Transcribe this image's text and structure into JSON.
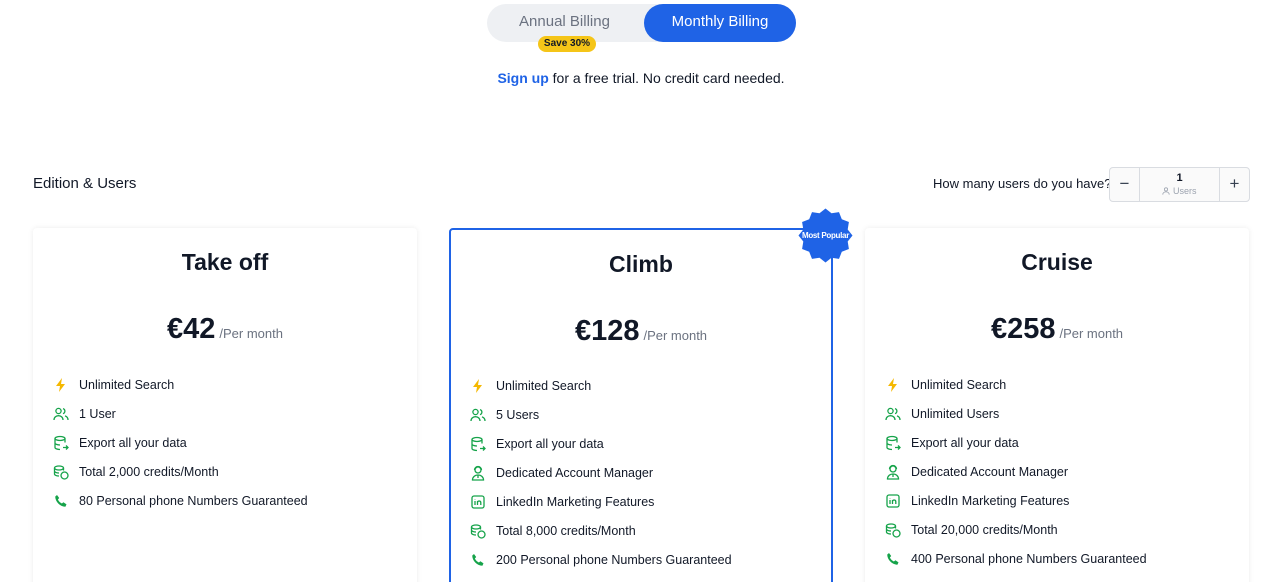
{
  "billing": {
    "annual_label": "Annual Billing",
    "monthly_label": "Monthly Billing",
    "save_badge": "Save 30%",
    "active": "monthly"
  },
  "signup": {
    "link_text": "Sign up",
    "rest_text": " for a free trial. No credit card needed."
  },
  "section_title": "Edition & Users",
  "users": {
    "question": "How many users do you have?",
    "value": "1",
    "unit": "Users",
    "minus": "−",
    "plus": "+"
  },
  "popular_badge": "Most Popular",
  "plans": [
    {
      "name": "Take off",
      "price": "€42",
      "period": "/Per month",
      "features": [
        {
          "icon": "lightning-icon",
          "text": "Unlimited Search"
        },
        {
          "icon": "users-icon",
          "text": "1 User"
        },
        {
          "icon": "export-database-icon",
          "text": "Export all your data"
        },
        {
          "icon": "coins-icon",
          "text": "Total 2,000 credits/Month"
        },
        {
          "icon": "phone-icon",
          "text": "80 Personal phone Numbers Guaranteed"
        }
      ]
    },
    {
      "name": "Climb",
      "price": "€128",
      "period": "/Per month",
      "features": [
        {
          "icon": "lightning-icon",
          "text": "Unlimited Search"
        },
        {
          "icon": "users-icon",
          "text": "5 Users"
        },
        {
          "icon": "export-database-icon",
          "text": "Export all your data"
        },
        {
          "icon": "account-manager-icon",
          "text": "Dedicated Account Manager"
        },
        {
          "icon": "linkedin-icon",
          "text": "LinkedIn Marketing Features"
        },
        {
          "icon": "coins-icon",
          "text": "Total 8,000 credits/Month"
        },
        {
          "icon": "phone-icon",
          "text": "200 Personal phone Numbers Guaranteed"
        }
      ]
    },
    {
      "name": "Cruise",
      "price": "€258",
      "period": "/Per month",
      "features": [
        {
          "icon": "lightning-icon",
          "text": "Unlimited Search"
        },
        {
          "icon": "users-icon",
          "text": "Unlimited Users"
        },
        {
          "icon": "export-database-icon",
          "text": "Export all your data"
        },
        {
          "icon": "account-manager-icon",
          "text": "Dedicated Account Manager"
        },
        {
          "icon": "linkedin-icon",
          "text": "LinkedIn Marketing Features"
        },
        {
          "icon": "coins-icon",
          "text": "Total 20,000 credits/Month"
        },
        {
          "icon": "phone-icon",
          "text": "400 Personal phone Numbers Guaranteed"
        }
      ]
    }
  ],
  "colors": {
    "accent": "#1f63e6",
    "badge_yellow": "#f5c518",
    "feature_green": "#16a34a",
    "lightning_yellow": "#f5b800"
  }
}
